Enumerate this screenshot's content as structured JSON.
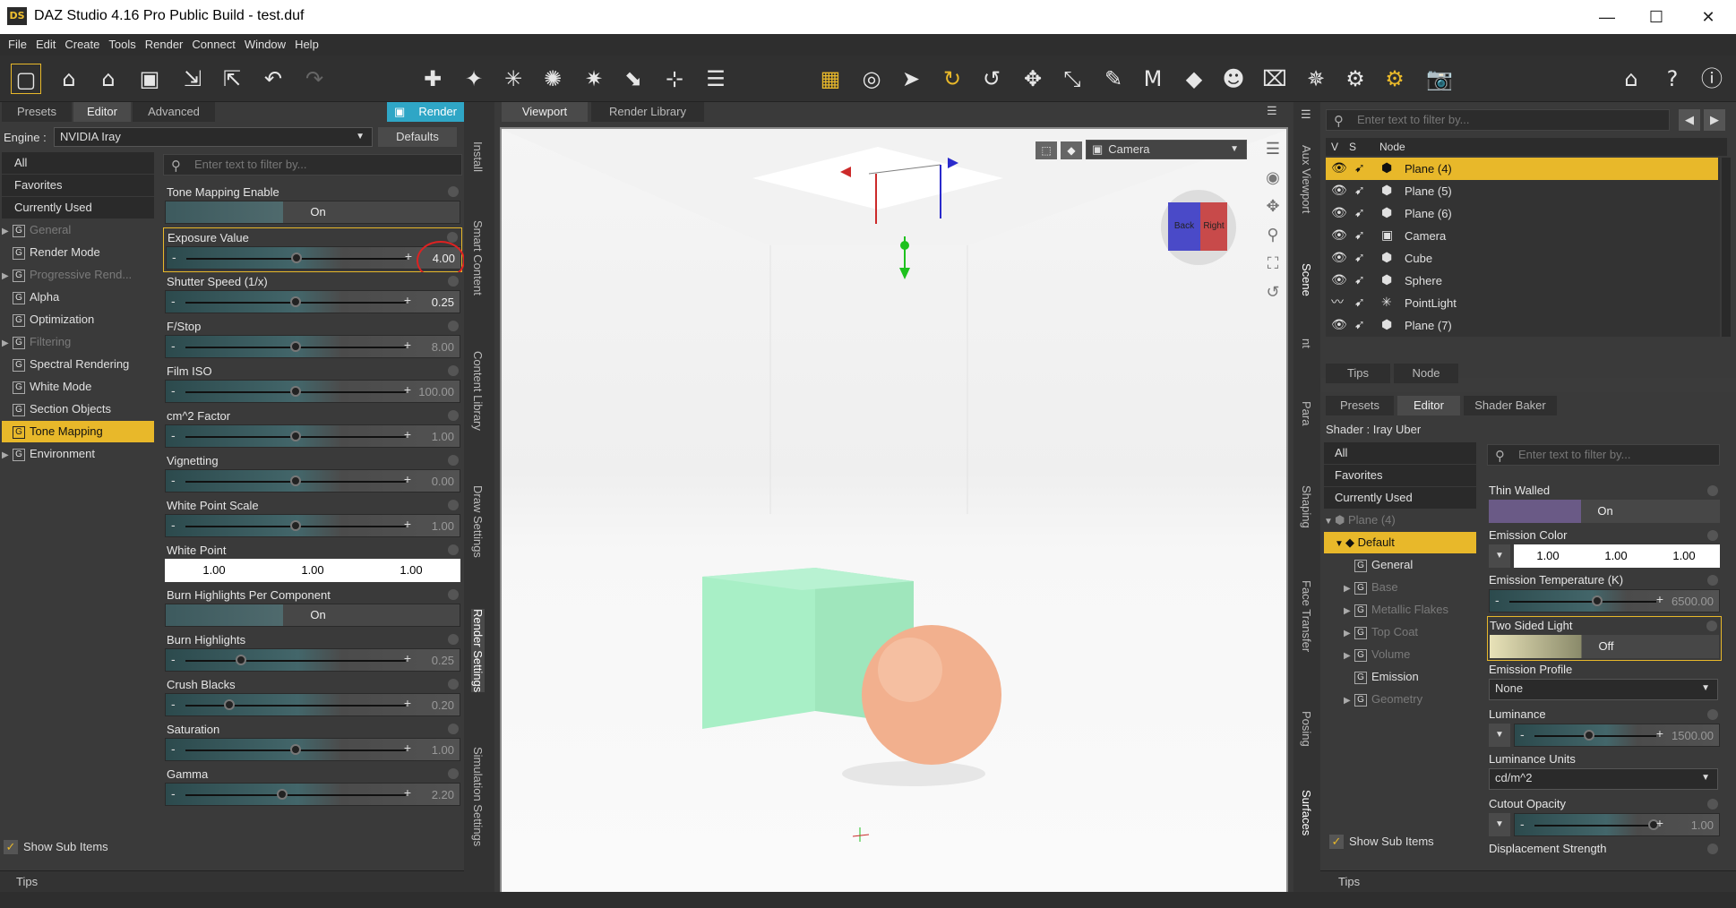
{
  "window": {
    "title": "DAZ Studio 4.16 Pro Public Build - test.duf",
    "logo": "DS"
  },
  "menu": [
    "File",
    "Edit",
    "Create",
    "Tools",
    "Render",
    "Connect",
    "Window",
    "Help"
  ],
  "left_tabs": {
    "presets": "Presets",
    "editor": "Editor",
    "advanced": "Advanced",
    "render": "Render"
  },
  "engine": {
    "label": "Engine :",
    "value": "NVIDIA Iray",
    "defaults": "Defaults"
  },
  "left_filter_placeholder": "Enter text to filter by...",
  "categories": [
    {
      "label": "All"
    },
    {
      "label": "Favorites"
    },
    {
      "label": "Currently Used"
    },
    {
      "label": "General"
    },
    {
      "label": "Render Mode"
    },
    {
      "label": "Progressive Rend..."
    },
    {
      "label": "Alpha"
    },
    {
      "label": "Optimization"
    },
    {
      "label": "Filtering"
    },
    {
      "label": "Spectral Rendering"
    },
    {
      "label": "White Mode"
    },
    {
      "label": "Section Objects"
    },
    {
      "label": "Tone Mapping"
    },
    {
      "label": "Environment"
    }
  ],
  "show_sub_items": "Show Sub Items",
  "tone_mapping": {
    "enable": {
      "label": "Tone Mapping Enable",
      "value": "On"
    },
    "exposure": {
      "label": "Exposure Value",
      "value": "4.00",
      "level": 0.5
    },
    "shutter": {
      "label": "Shutter Speed (1/x)",
      "value": "0.25",
      "level": 0.5
    },
    "fstop": {
      "label": "F/Stop",
      "value": "8.00",
      "level": 0.5
    },
    "film_iso": {
      "label": "Film ISO",
      "value": "100.00",
      "level": 0.5
    },
    "cm2": {
      "label": "cm^2 Factor",
      "value": "1.00",
      "level": 0.5
    },
    "vignetting": {
      "label": "Vignetting",
      "value": "0.00",
      "level": 0.5
    },
    "white_point_scale": {
      "label": "White Point Scale",
      "value": "1.00",
      "level": 0.5
    },
    "white_point": {
      "label": "White Point",
      "r": "1.00",
      "g": "1.00",
      "b": "1.00"
    },
    "burn_per_component": {
      "label": "Burn Highlights Per Component",
      "value": "On"
    },
    "burn": {
      "label": "Burn Highlights",
      "value": "0.25",
      "level": 0.25
    },
    "crush": {
      "label": "Crush Blacks",
      "value": "0.20",
      "level": 0.2
    },
    "saturation": {
      "label": "Saturation",
      "value": "1.00",
      "level": 0.5
    },
    "gamma": {
      "label": "Gamma",
      "value": "2.20",
      "level": 0.44
    }
  },
  "left_side_tabs": [
    "Install",
    "Smart Content",
    "Content Library",
    "Draw Settings",
    "Render Settings",
    "Simulation Settings"
  ],
  "viewport_tabs": {
    "viewport": "Viewport",
    "render_library": "Render Library"
  },
  "camera": "Camera",
  "cube_faces": {
    "left": "Back",
    "right": "Right"
  },
  "right_side_tabs": [
    "Aux Viewport",
    "Scene",
    "nt",
    "Para",
    "Shaping",
    "Face Transfer",
    "Posing",
    "Surfaces"
  ],
  "scene": {
    "filter_placeholder": "Enter text to filter by...",
    "col_v": "V",
    "col_s": "S",
    "col_node": "Node",
    "nodes": [
      {
        "name": "Plane (4)",
        "icon": "figure-icon"
      },
      {
        "name": "Plane (5)",
        "icon": "figure-icon"
      },
      {
        "name": "Plane (6)",
        "icon": "figure-icon"
      },
      {
        "name": "Camera",
        "icon": "camera-icon"
      },
      {
        "name": "Cube",
        "icon": "figure-icon"
      },
      {
        "name": "Sphere",
        "icon": "figure-icon"
      },
      {
        "name": "PointLight",
        "icon": "light-icon"
      },
      {
        "name": "Plane (7)",
        "icon": "figure-icon"
      }
    ],
    "tips": "Tips",
    "node_tab": "Node"
  },
  "surfaces": {
    "tabs": {
      "presets": "Presets",
      "editor": "Editor",
      "shader_baker": "Shader Baker"
    },
    "shader": "Shader : Iray Uber",
    "filter_placeholder": "Enter text to filter by...",
    "tree": [
      {
        "label": "All"
      },
      {
        "label": "Favorites"
      },
      {
        "label": "Currently Used"
      },
      {
        "label": "Plane (4)"
      },
      {
        "label": "Default"
      },
      {
        "label": "General"
      },
      {
        "label": "Base"
      },
      {
        "label": "Metallic Flakes"
      },
      {
        "label": "Top Coat"
      },
      {
        "label": "Volume"
      },
      {
        "label": "Emission"
      },
      {
        "label": "Geometry"
      }
    ],
    "thin_walled": {
      "label": "Thin Walled",
      "value": "On"
    },
    "emission_color": {
      "label": "Emission Color",
      "r": "1.00",
      "g": "1.00",
      "b": "1.00"
    },
    "emission_temp": {
      "label": "Emission Temperature (K)",
      "value": "6500.00",
      "level": 0.6
    },
    "two_sided": {
      "label": "Two Sided Light",
      "value": "Off"
    },
    "emission_profile": {
      "label": "Emission Profile",
      "value": "None"
    },
    "luminance": {
      "label": "Luminance",
      "value": "1500.00",
      "level": 0.45
    },
    "luminance_units": {
      "label": "Luminance Units",
      "value": "cd/m^2"
    },
    "cutout": {
      "label": "Cutout Opacity",
      "value": "1.00",
      "level": 0.98
    },
    "displacement": {
      "label": "Displacement Strength"
    },
    "show_sub_items": "Show Sub Items",
    "tips": "Tips"
  },
  "bottom_tips_left": "Tips",
  "colors": {
    "accent": "#e8b82a",
    "render_btn": "#2fa6c6",
    "cube": "#a8efc6",
    "sphere": "#f2b08e"
  }
}
